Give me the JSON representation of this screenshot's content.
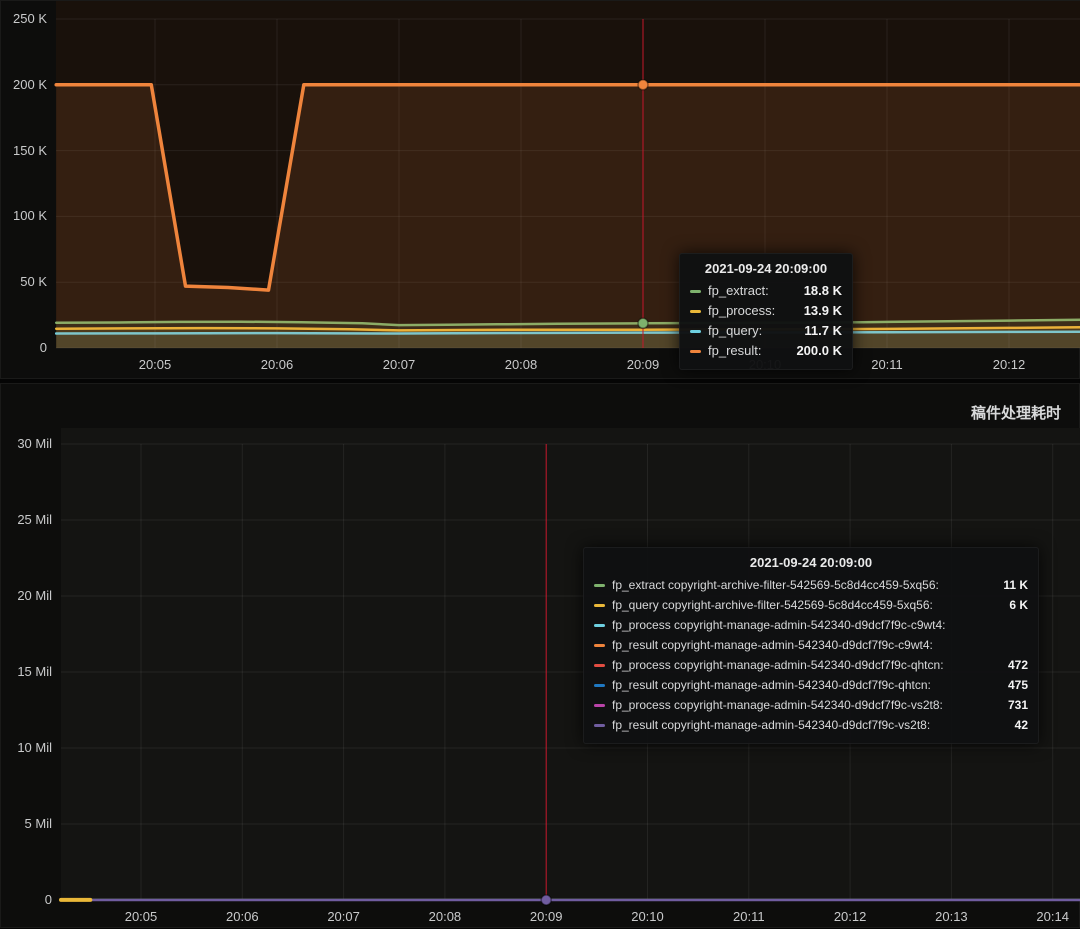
{
  "colors": {
    "green": "#7EB26D",
    "yellow": "#EAB839",
    "teal": "#6ED0E0",
    "orange": "#EF843C",
    "red": "#E24D42",
    "blue": "#1F78C1",
    "magenta": "#BA43A9",
    "violet": "#705DA0",
    "cursor": "#C4162A"
  },
  "top_panel": {
    "tooltip": {
      "timestamp": "2021-09-24 20:09:00",
      "rows": [
        {
          "color": "#7EB26D",
          "label": "fp_extract:",
          "value": "18.8 K"
        },
        {
          "color": "#EAB839",
          "label": "fp_process:",
          "value": "13.9 K"
        },
        {
          "color": "#6ED0E0",
          "label": "fp_query:",
          "value": "11.7 K"
        },
        {
          "color": "#EF843C",
          "label": "fp_result:",
          "value": "200.0 K"
        }
      ]
    }
  },
  "bottom_panel": {
    "title": "稿件处理耗时",
    "tooltip": {
      "timestamp": "2021-09-24 20:09:00",
      "rows": [
        {
          "color": "#7EB26D",
          "label": "fp_extract copyright-archive-filter-542569-5c8d4cc459-5xq56:",
          "value": "11 K"
        },
        {
          "color": "#EAB839",
          "label": "fp_query copyright-archive-filter-542569-5c8d4cc459-5xq56:",
          "value": "6 K"
        },
        {
          "color": "#6ED0E0",
          "label": "fp_process copyright-manage-admin-542340-d9dcf7f9c-c9wt4:",
          "value": ""
        },
        {
          "color": "#EF843C",
          "label": "fp_result copyright-manage-admin-542340-d9dcf7f9c-c9wt4:",
          "value": ""
        },
        {
          "color": "#E24D42",
          "label": "fp_process copyright-manage-admin-542340-d9dcf7f9c-qhtcn:",
          "value": "472"
        },
        {
          "color": "#1F78C1",
          "label": "fp_result copyright-manage-admin-542340-d9dcf7f9c-qhtcn:",
          "value": "475"
        },
        {
          "color": "#BA43A9",
          "label": "fp_process copyright-manage-admin-542340-d9dcf7f9c-vs2t8:",
          "value": "731"
        },
        {
          "color": "#705DA0",
          "label": "fp_result copyright-manage-admin-542340-d9dcf7f9c-vs2t8:",
          "value": "42"
        }
      ]
    }
  },
  "chart_data": [
    {
      "type": "line",
      "title": "",
      "cursor": {
        "minute": 9,
        "time": "2021-09-24 20:09:00"
      },
      "x_axis": {
        "unit": "time",
        "tick_labels": [
          "20:05",
          "20:06",
          "20:07",
          "20:08",
          "20:09",
          "20:10",
          "20:11",
          "20:12"
        ],
        "tick_minutes": [
          5,
          6,
          7,
          8,
          9,
          10,
          11,
          12
        ],
        "range_minutes": [
          4.19,
          12.59
        ]
      },
      "y_axis": {
        "tick_labels": [
          "0",
          "50 K",
          "100 K",
          "150 K",
          "200 K",
          "250 K"
        ],
        "tick_values": [
          0,
          50000,
          100000,
          150000,
          200000,
          250000
        ],
        "ylim": [
          0,
          250000
        ]
      },
      "series": [
        {
          "name": "fp_extract",
          "color": "#7EB26D",
          "width": 2.5,
          "fill_opacity": 0.1,
          "points": [
            [
              4.19,
              19200
            ],
            [
              4.7,
              19400
            ],
            [
              5.2,
              19800
            ],
            [
              5.7,
              20000
            ],
            [
              6.2,
              19600
            ],
            [
              6.7,
              18800
            ],
            [
              7.0,
              17400
            ],
            [
              7.4,
              17600
            ],
            [
              7.8,
              18000
            ],
            [
              8.3,
              18400
            ],
            [
              9.0,
              18800
            ],
            [
              9.6,
              19000
            ],
            [
              10.2,
              19200
            ],
            [
              10.8,
              19600
            ],
            [
              11.4,
              20200
            ],
            [
              12.0,
              20800
            ],
            [
              12.59,
              21400
            ]
          ]
        },
        {
          "name": "fp_process",
          "color": "#EAB839",
          "width": 2.5,
          "fill_opacity": 0.1,
          "points": [
            [
              4.19,
              14600
            ],
            [
              4.8,
              14900
            ],
            [
              5.4,
              15100
            ],
            [
              6.0,
              14900
            ],
            [
              6.6,
              14300
            ],
            [
              7.0,
              13400
            ],
            [
              7.5,
              13700
            ],
            [
              8.0,
              13900
            ],
            [
              8.6,
              13800
            ],
            [
              9.0,
              13900
            ],
            [
              9.6,
              14100
            ],
            [
              10.2,
              14200
            ],
            [
              10.8,
              14400
            ],
            [
              11.4,
              14800
            ],
            [
              12.0,
              15300
            ],
            [
              12.59,
              15700
            ]
          ]
        },
        {
          "name": "fp_query",
          "color": "#6ED0E0",
          "width": 2.5,
          "fill_opacity": 0.08,
          "points": [
            [
              4.19,
              11000
            ],
            [
              5.0,
              11100
            ],
            [
              6.0,
              11300
            ],
            [
              7.0,
              11000
            ],
            [
              8.0,
              11400
            ],
            [
              9.0,
              11700
            ],
            [
              10.0,
              11800
            ],
            [
              11.0,
              12000
            ],
            [
              12.0,
              12200
            ],
            [
              12.59,
              12300
            ]
          ]
        },
        {
          "name": "fp_result",
          "color": "#EF843C",
          "width": 3.5,
          "fill_opacity": 0.13,
          "points": [
            [
              4.19,
              200000
            ],
            [
              4.97,
              200000
            ],
            [
              5.25,
              47000
            ],
            [
              5.6,
              46000
            ],
            [
              5.93,
              44000
            ],
            [
              6.22,
              200000
            ],
            [
              12.59,
              200000
            ]
          ]
        }
      ],
      "highlights": [
        {
          "series": "fp_result",
          "minute": 9,
          "value": 200000
        },
        {
          "series": "fp_extract",
          "minute": 9,
          "value": 18800
        }
      ]
    },
    {
      "type": "line",
      "title": "稿件处理耗时",
      "cursor": {
        "minute": 9,
        "time": "2021-09-24 20:09:00"
      },
      "x_axis": {
        "unit": "time",
        "tick_labels": [
          "20:05",
          "20:06",
          "20:07",
          "20:08",
          "20:09",
          "20:10",
          "20:11",
          "20:12",
          "20:13",
          "20:14"
        ],
        "tick_minutes": [
          5,
          6,
          7,
          8,
          9,
          10,
          11,
          12,
          13,
          14
        ],
        "range_minutes": [
          4.21,
          14.28
        ]
      },
      "y_axis": {
        "tick_labels": [
          "0",
          "5 Mil",
          "10 Mil",
          "15 Mil",
          "20 Mil",
          "25 Mil",
          "30 Mil"
        ],
        "tick_values": [
          0,
          5000000,
          10000000,
          15000000,
          20000000,
          25000000,
          30000000
        ],
        "ylim": [
          0,
          30000000
        ]
      },
      "series": [
        {
          "name": "fp_extract copyright-archive-filter-542569-5c8d4cc459-5xq56",
          "color": "#7EB26D",
          "width": 2,
          "points": [
            [
              4.21,
              11000
            ],
            [
              14.28,
              11000
            ]
          ]
        },
        {
          "name": "fp_process copyright-manage-admin-542340-d9dcf7f9c-c9wt4",
          "color": "#6ED0E0",
          "width": 2,
          "points": [
            [
              4.21,
              0
            ],
            [
              14.28,
              0
            ]
          ]
        },
        {
          "name": "fp_result copyright-manage-admin-542340-d9dcf7f9c-c9wt4",
          "color": "#EF843C",
          "width": 2,
          "points": [
            [
              4.21,
              0
            ],
            [
              14.28,
              0
            ]
          ]
        },
        {
          "name": "fp_process copyright-manage-admin-542340-d9dcf7f9c-qhtcn",
          "color": "#E24D42",
          "width": 2,
          "points": [
            [
              4.21,
              472
            ],
            [
              14.28,
              472
            ]
          ]
        },
        {
          "name": "fp_result copyright-manage-admin-542340-d9dcf7f9c-qhtcn",
          "color": "#1F78C1",
          "width": 2,
          "points": [
            [
              4.21,
              475
            ],
            [
              14.28,
              475
            ]
          ]
        },
        {
          "name": "fp_process copyright-manage-admin-542340-d9dcf7f9c-vs2t8",
          "color": "#BA43A9",
          "width": 2,
          "points": [
            [
              4.21,
              731
            ],
            [
              14.28,
              731
            ]
          ]
        },
        {
          "name": "fp_result copyright-manage-admin-542340-d9dcf7f9c-vs2t8",
          "color": "#705DA0",
          "width": 2.5,
          "points": [
            [
              4.21,
              42
            ],
            [
              14.28,
              42
            ]
          ]
        },
        {
          "name": "fp_query copyright-archive-filter-542569-5c8d4cc459-5xq56",
          "color": "#EAB839",
          "width": 4,
          "points": [
            [
              4.21,
              6000
            ],
            [
              4.5,
              6000
            ]
          ]
        }
      ],
      "highlights": [
        {
          "series": "fp_result copyright-manage-admin-542340-d9dcf7f9c-vs2t8",
          "minute": 9,
          "value": 42
        }
      ]
    }
  ]
}
